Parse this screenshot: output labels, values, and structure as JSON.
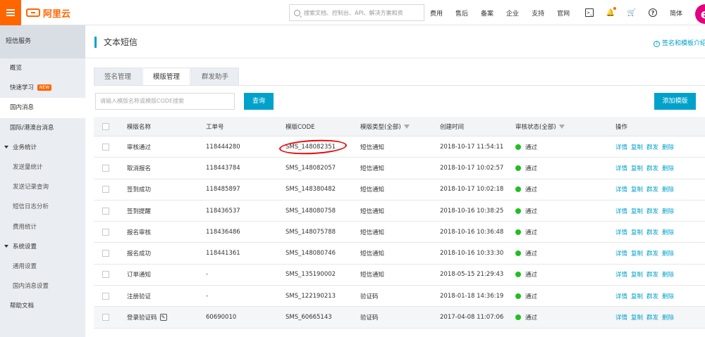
{
  "topbar": {
    "brand": "阿里云",
    "search_placeholder": "搜索文档、控制台、API、解决方案和资",
    "nav": [
      "费用",
      "售后",
      "备案",
      "企业",
      "支持",
      "官网"
    ],
    "lang": "简体",
    "avatar_letter": "e",
    "notification_dot_color": "#ff6600"
  },
  "sidebar": {
    "title": "短信服务",
    "items": [
      {
        "label": "概览"
      },
      {
        "label": "快速学习",
        "badge": "NEW"
      },
      {
        "label": "国内消息"
      },
      {
        "label": "国际/港澳台消息"
      },
      {
        "label": "业务统计"
      },
      {
        "label": "发送量统计"
      },
      {
        "label": "发送记录查询"
      },
      {
        "label": "短信日志分析"
      },
      {
        "label": "费用统计"
      },
      {
        "label": "系统设置"
      },
      {
        "label": "通用设置"
      },
      {
        "label": "国内消息设置"
      },
      {
        "label": "帮助文档"
      }
    ]
  },
  "page": {
    "title": "文本短信",
    "help_link": "签名和模板介绍",
    "tabs": [
      "签名管理",
      "模版管理",
      "群发助手"
    ],
    "active_tab": "模版管理",
    "filter_placeholder": "请输入模版名称或模版CODE搜索",
    "query_label": "查询",
    "add_label": "添加模版"
  },
  "table": {
    "headers": [
      "模版名称",
      "工单号",
      "模版CODE",
      "模版类型(全部)",
      "创建时间",
      "审核状态(全部)",
      "操作"
    ],
    "actions": [
      "详情",
      "复制",
      "群发",
      "删除"
    ],
    "status_color": "#1dc11d",
    "rows": [
      {
        "name": "审核通过",
        "ticket": "118444280",
        "code": "SMS_148082351",
        "type": "短信通知",
        "created": "2018-10-17 11:54:11",
        "status": "通过"
      },
      {
        "name": "取消报名",
        "ticket": "118443784",
        "code": "SMS_148082057",
        "type": "短信通知",
        "created": "2018-10-17 10:02:57",
        "status": "通过"
      },
      {
        "name": "签到成功",
        "ticket": "118485897",
        "code": "SMS_148380482",
        "type": "短信通知",
        "created": "2018-10-17 10:02:18",
        "status": "通过"
      },
      {
        "name": "签到提醒",
        "ticket": "118436537",
        "code": "SMS_148080758",
        "type": "短信通知",
        "created": "2018-10-16 10:38:25",
        "status": "通过"
      },
      {
        "name": "报名审核",
        "ticket": "118436486",
        "code": "SMS_148075788",
        "type": "短信通知",
        "created": "2018-10-16 10:36:48",
        "status": "通过"
      },
      {
        "name": "报名成功",
        "ticket": "118441361",
        "code": "SMS_148080746",
        "type": "短信通知",
        "created": "2018-10-16 10:33:30",
        "status": "通过"
      },
      {
        "name": "订单通知",
        "ticket": "-",
        "code": "SMS_135190002",
        "type": "短信通知",
        "created": "2018-05-15 21:29:43",
        "status": "通过"
      },
      {
        "name": "注册验证",
        "ticket": "-",
        "code": "SMS_122190213",
        "type": "验证码",
        "created": "2018-01-18 14:36:19",
        "status": "通过"
      },
      {
        "name": "登录验证码",
        "ticket": "60690010",
        "code": "SMS_60665143",
        "type": "验证码",
        "created": "2017-04-08 11:07:06",
        "status": "通过"
      }
    ]
  }
}
